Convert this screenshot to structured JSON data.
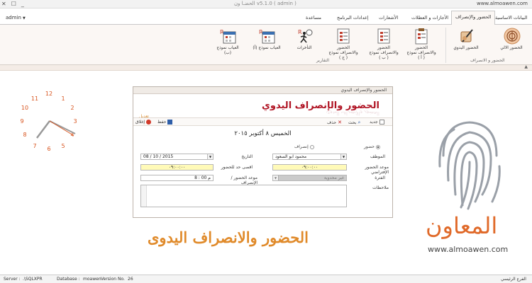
{
  "window": {
    "domain": "www.almoawen.com",
    "title": "الحضـا ون v5.1.0 ( admin )",
    "controls": [
      "✕",
      "☐",
      "_"
    ]
  },
  "menu": {
    "tabs": [
      "البيانات الاساسية",
      "الحضور والإنصراف",
      "الأجازات و العطلات",
      "الأشعارات",
      "إعدادات البرنامج",
      "مساعدة"
    ],
    "active": "الحضور والإنصراف",
    "user": "admin"
  },
  "ribbon": {
    "buttons": {
      "auto": "الحضور الالي",
      "manual": "الحضور اليدوي",
      "form_a": "الحضور والانصراف نموذج ( أ )",
      "form_b": "الحضور والانصراف نموذج ( ب )",
      "form_c": "الحضور والانصراف نموذج ( ج )",
      "lateness": "التأخرات",
      "absence_a": "الغياب نموذج (أ)",
      "absence_b": "الغياب نموذج (ب)"
    },
    "groups": {
      "attendance": "الحضور و الانصراف",
      "reports": "التقارير"
    }
  },
  "clock": {
    "numbers": [
      "12",
      "1",
      "2",
      "3",
      "4",
      "5",
      "6",
      "7",
      "8",
      "9",
      "10",
      "11"
    ]
  },
  "dialog": {
    "title": "الحضور والإنصراف اليدوي",
    "banner_title": "الحضور والإنصراف اليدوي",
    "banner_shadow": "الحضور والإنصراف اليدوي",
    "edit_label": "تعديل",
    "toolbar": {
      "new": "جديد",
      "search": "بحث",
      "delete": "حذف",
      "save": "حفظ",
      "close": "إغلاق"
    },
    "date_heading": "الخميس ٨ أكتوبر ٢٠١٥",
    "radio_attendance": "حضور",
    "radio_leave": "إنصراف",
    "labels": {
      "employee": "الموظف",
      "virtual_time": "موعد الحضور الإفتراضي",
      "shift": "الفترة",
      "date": "التاريخ",
      "max_limit": "اقصى حد للحضور",
      "actual_time": "موعد الحضور / الإنصراف",
      "notes": "ملاحظات"
    },
    "values": {
      "employee": "محمود ابو السعود",
      "virtual_time": "٠٩:٠٠:٠٠",
      "shift": "غير محدوية",
      "date": "08 / 10 / 2015",
      "max_limit": "٠٩:٠٠:٠٠",
      "actual_time": "م  00 : 8",
      "notes": ""
    }
  },
  "brand": {
    "caption": "الحضور والانصراف اليدوى",
    "logo_text": "المعاون",
    "url": "www.almoawen.com"
  },
  "statusbar": {
    "server_label": "Server :",
    "server": ".\\SQLXPR",
    "db_label": "Database :",
    "db": "moawen",
    "version_label": "Version No.",
    "version": "26",
    "branch": "الفرع الرئيسي"
  },
  "colors": {
    "accent_red": "#b01424",
    "brand_orange": "#e06a2a",
    "ribbon_bg": "#fbf7f4"
  }
}
